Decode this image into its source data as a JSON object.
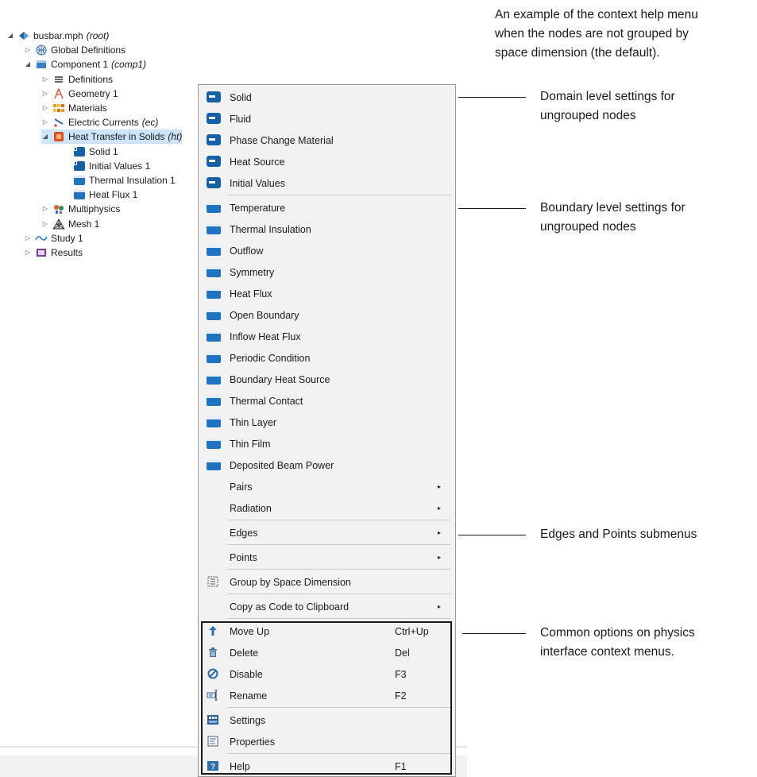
{
  "tree": [
    {
      "label": "busbar.mph",
      "suffix": "(root)",
      "twisty": "open",
      "icon": "model-icon",
      "depth": 0
    },
    {
      "label": "Global Definitions",
      "suffix": "",
      "twisty": "closed",
      "icon": "globe-icon",
      "depth": 1
    },
    {
      "label": "Component 1",
      "suffix": "(comp1)",
      "twisty": "open",
      "icon": "component-icon",
      "depth": 1
    },
    {
      "label": "Definitions",
      "suffix": "",
      "twisty": "closed",
      "icon": "definitions-icon",
      "depth": 2
    },
    {
      "label": "Geometry 1",
      "suffix": "",
      "twisty": "closed",
      "icon": "geometry-icon",
      "depth": 2
    },
    {
      "label": "Materials",
      "suffix": "",
      "twisty": "closed",
      "icon": "materials-icon",
      "depth": 2
    },
    {
      "label": "Electric Currents",
      "suffix": "(ec)",
      "twisty": "closed",
      "icon": "electric-currents-icon",
      "depth": 2
    },
    {
      "label": "Heat Transfer in Solids",
      "suffix": "(ht)",
      "twisty": "open",
      "icon": "heat-transfer-icon",
      "depth": 2,
      "selected": true
    },
    {
      "label": "Solid 1",
      "suffix": "",
      "twisty": "none",
      "icon": "domain-node-icon",
      "depth": 3
    },
    {
      "label": "Initial Values 1",
      "suffix": "",
      "twisty": "none",
      "icon": "domain-node-icon",
      "depth": 3
    },
    {
      "label": "Thermal Insulation 1",
      "suffix": "",
      "twisty": "none",
      "icon": "boundary-node-icon",
      "depth": 3
    },
    {
      "label": "Heat Flux 1",
      "suffix": "",
      "twisty": "none",
      "icon": "boundary-node-icon",
      "depth": 3
    },
    {
      "label": "Multiphysics",
      "suffix": "",
      "twisty": "closed",
      "icon": "multiphysics-icon",
      "depth": 2
    },
    {
      "label": "Mesh 1",
      "suffix": "",
      "twisty": "closed",
      "icon": "mesh-icon",
      "depth": 2
    },
    {
      "label": "Study 1",
      "suffix": "",
      "twisty": "closed",
      "icon": "study-icon",
      "depth": 1
    },
    {
      "label": "Results",
      "suffix": "",
      "twisty": "closed",
      "icon": "results-icon",
      "depth": 1
    }
  ],
  "menu": {
    "domain_items": [
      "Solid",
      "Fluid",
      "Phase Change Material",
      "Heat Source",
      "Initial Values"
    ],
    "boundary_items": [
      "Temperature",
      "Thermal Insulation",
      "Outflow",
      "Symmetry",
      "Heat Flux",
      "Open Boundary",
      "Inflow Heat Flux",
      "Periodic Condition",
      "Boundary Heat Source",
      "Thermal Contact",
      "Thin Layer",
      "Thin Film",
      "Deposited Beam Power"
    ],
    "submenus_a": [
      "Pairs",
      "Radiation"
    ],
    "submenus_b": [
      "Edges"
    ],
    "submenus_c": [
      "Points"
    ],
    "group_by_label": "Group by Space Dimension",
    "copy_code_label": "Copy as Code to Clipboard",
    "common": [
      {
        "label": "Move Up",
        "shortcut": "Ctrl+Up",
        "icon": "arrow-up-icon"
      },
      {
        "label": "Delete",
        "shortcut": "Del",
        "icon": "trash-icon"
      },
      {
        "label": "Disable",
        "shortcut": "F3",
        "icon": "disable-icon"
      },
      {
        "label": "Rename",
        "shortcut": "F2",
        "icon": "rename-icon"
      }
    ],
    "settings_items": [
      {
        "label": "Settings",
        "shortcut": "",
        "icon": "settings-icon"
      },
      {
        "label": "Properties",
        "shortcut": "",
        "icon": "properties-icon"
      }
    ],
    "help_item": {
      "label": "Help",
      "shortcut": "F1",
      "icon": "help-icon"
    },
    "arrow_glyph": "▸"
  },
  "annotations": {
    "intro": [
      "An example of the context help menu",
      "when the nodes are not grouped by",
      "space dimension (the default)."
    ],
    "domain": [
      "Domain level settings for",
      "ungrouped nodes"
    ],
    "boundary": [
      "Boundary level settings for",
      "ungrouped nodes"
    ],
    "edges": [
      "Edges and Points submenus"
    ],
    "common": [
      "Common options on physics",
      "interface context menus."
    ]
  },
  "colors": {
    "selection": "#cce4f7",
    "domain_icon": "#1660a8",
    "boundary_icon": "#1f74c2",
    "menu_bg": "#f2f2f2"
  }
}
